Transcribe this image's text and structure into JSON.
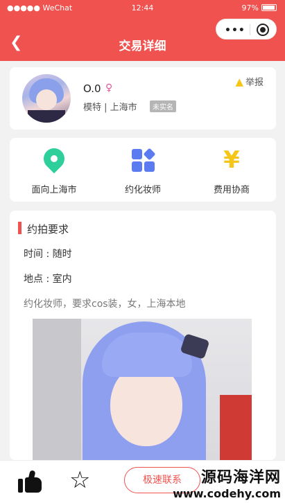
{
  "status_bar": {
    "carrier": "●●●●● WeChat",
    "time": "12:44",
    "battery": "97%"
  },
  "nav": {
    "title": "交易详细",
    "back_icon": "chevron-left-icon",
    "menu_icon": "more-dots-icon",
    "close_icon": "target-icon"
  },
  "profile": {
    "name": "O.0",
    "gender_symbol": "♀",
    "meta": "模特 | 上海市",
    "verification_badge": "未实名",
    "report_label": "举报"
  },
  "features": [
    {
      "label": "面向上海市",
      "icon": "location-pin-icon"
    },
    {
      "label": "约化妆师",
      "icon": "apps-grid-icon"
    },
    {
      "label": "费用协商",
      "icon": "yen-icon"
    }
  ],
  "requirements": {
    "title": "约拍要求",
    "time_line": "时间 : 随时",
    "place_line": "地点 : 室内",
    "description": "约化妆师，要求cos装，女，上海本地"
  },
  "bottom_bar": {
    "like_icon": "thumbs-up-icon",
    "favorite_icon": "star-icon",
    "contact_label": "极速联系"
  },
  "watermark": {
    "name": "源码海洋网",
    "url": "www.codehy.com"
  },
  "colors": {
    "accent": "#f0524f",
    "pin": "#2ecf9b",
    "grid": "#5b7cf0",
    "yen": "#f5c518"
  }
}
